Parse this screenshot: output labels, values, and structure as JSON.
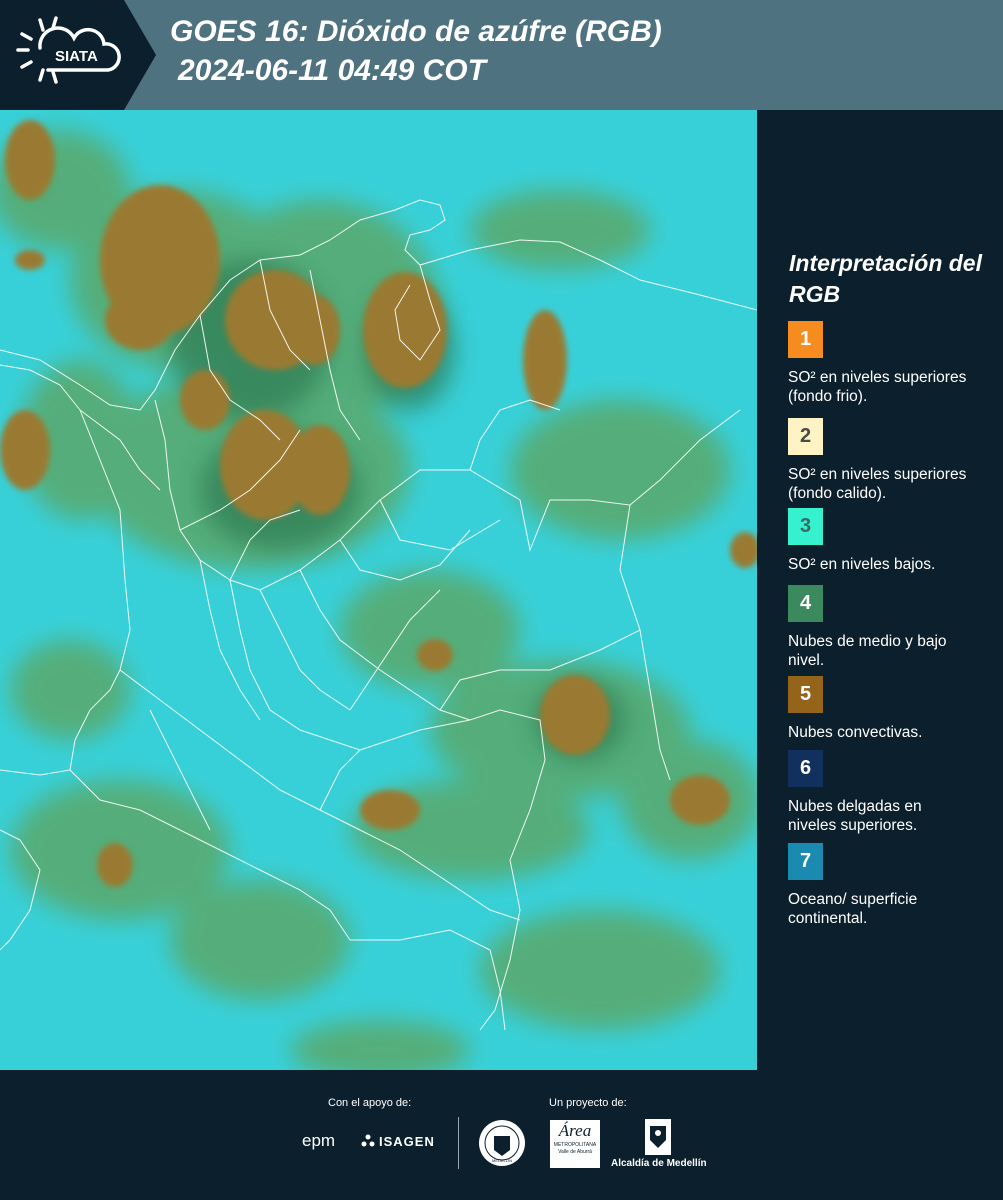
{
  "header": {
    "logo_text": "SIATA",
    "title_line1": "GOES 16: Dióxido de azúfre (RGB)",
    "title_line2": "2024-06-11 04:49 COT"
  },
  "legend": {
    "title": "Interpretación del RGB",
    "items": [
      {
        "number": "1",
        "color": "#f68b1f",
        "text_color": "#ffffff",
        "label": "SO² en niveles superiores (fondo frio)."
      },
      {
        "number": "2",
        "color": "#fdf3c5",
        "text_color": "#4a4a4a",
        "label": "SO² en niveles superiores (fondo calido)."
      },
      {
        "number": "3",
        "color": "#36f1cd",
        "text_color": "#3a6a66",
        "label": "SO² en niveles bajos."
      },
      {
        "number": "4",
        "color": "#3a8a5e",
        "text_color": "#ffffff",
        "label": "Nubes de medio y bajo nivel."
      },
      {
        "number": "5",
        "color": "#94641b",
        "text_color": "#ffffff",
        "label": "Nubes convectivas."
      },
      {
        "number": "6",
        "color": "#12305d",
        "text_color": "#ffffff",
        "label": "Nubes delgadas en niveles superiores."
      },
      {
        "number": "7",
        "color": "#1a8ab0",
        "text_color": "#ffffff",
        "label": "Oceano/ superficie continental."
      }
    ]
  },
  "footer": {
    "support_label": "Con el apoyo de:",
    "project_label": "Un proyecto de:",
    "sponsor1": "epm",
    "sponsor2": "ISAGEN",
    "partner1_seal": "MEDELLIN",
    "partner2": "Área",
    "partner2_sub": "METROPOLITANA",
    "partner2_sub2": "Valle de Aburrá",
    "partner3": "Alcaldía de Medellín"
  },
  "colors": {
    "header_bg": "#4e7280",
    "logo_bg": "#0c1f2c",
    "page_bg": "#0c1f2c",
    "map_cyan": "#35cfd6",
    "map_green": "#5aa86a",
    "map_convective": "#9a7a30"
  }
}
